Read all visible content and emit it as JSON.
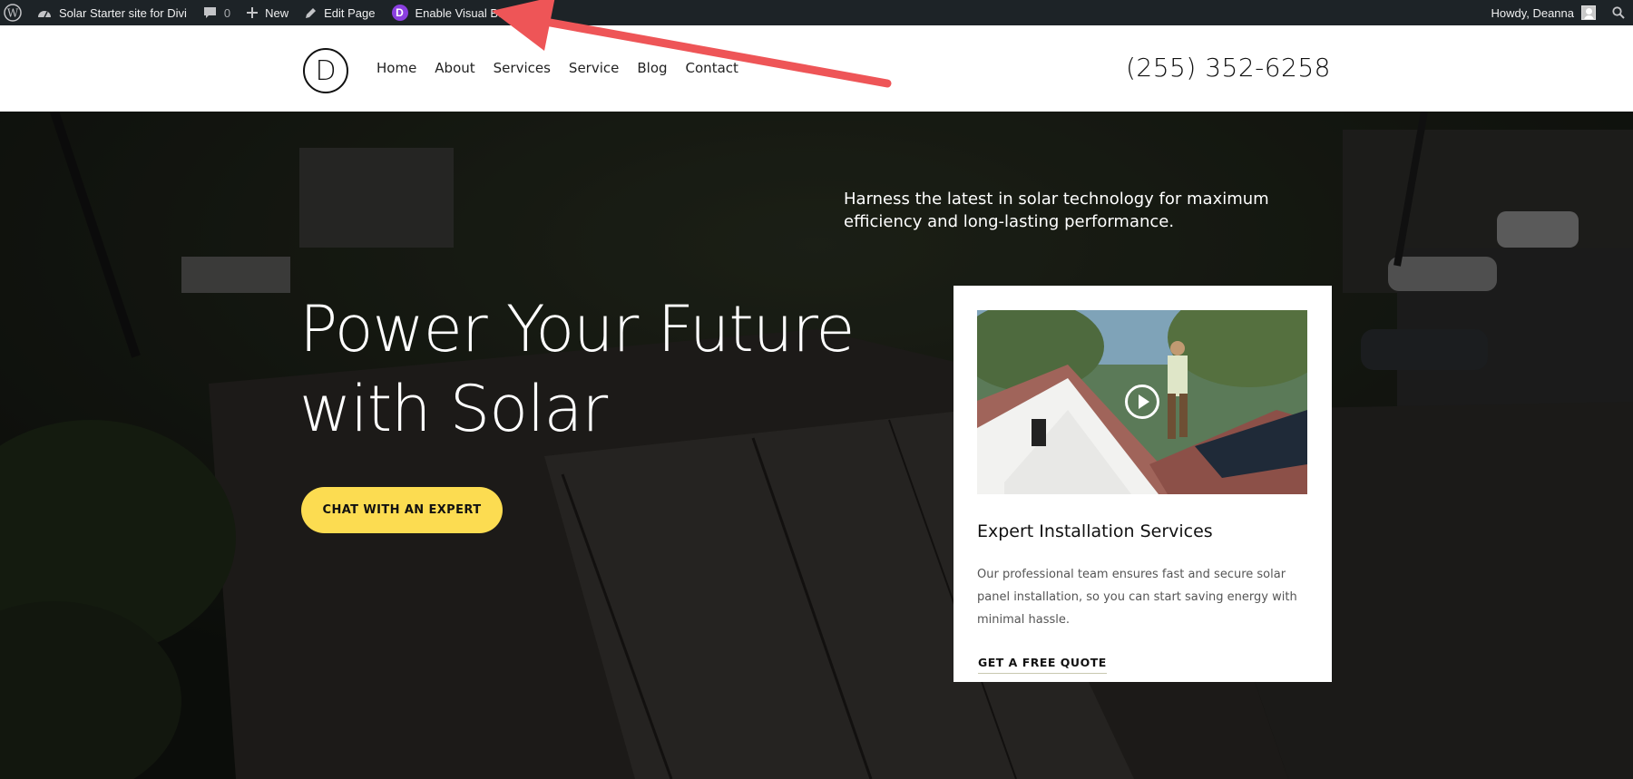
{
  "adminbar": {
    "site_name": "Solar Starter site for Divi",
    "comments_count": "0",
    "new_label": "New",
    "edit_label": "Edit Page",
    "divi_badge": "D",
    "visual_builder_label": "Enable Visual Builder",
    "howdy": "Howdy, Deanna"
  },
  "header": {
    "logo_letter": "D",
    "nav": [
      "Home",
      "About",
      "Services",
      "Service",
      "Blog",
      "Contact"
    ],
    "phone": "(255) 352-6258"
  },
  "hero": {
    "tagline": "Harness the latest in solar technology for maximum efficiency and long-lasting performance.",
    "headline_line1": "Power Your Future",
    "headline_line2": "with Solar",
    "cta_label": "CHAT WITH AN EXPERT"
  },
  "card": {
    "title": "Expert Installation Services",
    "description": "Our professional team ensures fast and secure solar panel installation, so you can start saving energy with minimal hassle.",
    "link_label": "GET A FREE QUOTE"
  },
  "colors": {
    "admin_bar": "#1d2327",
    "cta_yellow": "#fcdc51",
    "divi_purple": "#8b3fe0",
    "arrow_red": "#ee5557"
  }
}
